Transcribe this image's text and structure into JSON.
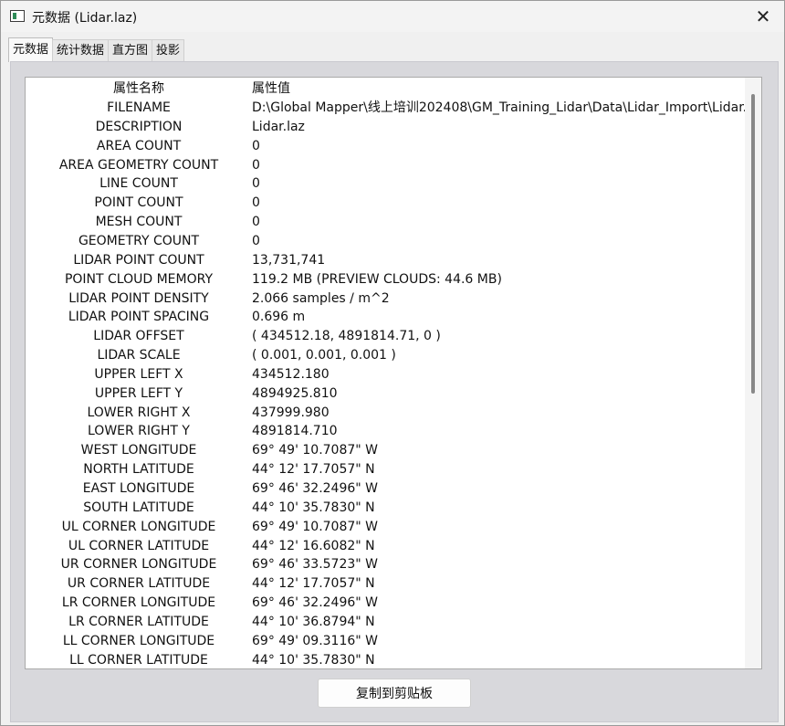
{
  "window": {
    "title": "元数据 (Lidar.laz)",
    "close_symbol": "✕"
  },
  "tabs": [
    {
      "label": "元数据",
      "active": true
    },
    {
      "label": "统计数据",
      "active": false
    },
    {
      "label": "直方图",
      "active": false
    },
    {
      "label": "投影",
      "active": false
    }
  ],
  "table": {
    "headers": {
      "name": "属性名称",
      "value": "属性值"
    },
    "rows": [
      {
        "name": "FILENAME",
        "value": "D:\\Global Mapper\\线上培训202408\\GM_Training_Lidar\\Data\\Lidar_Import\\Lidar.laz"
      },
      {
        "name": "DESCRIPTION",
        "value": "Lidar.laz"
      },
      {
        "name": "AREA COUNT",
        "value": "0"
      },
      {
        "name": "AREA GEOMETRY COUNT",
        "value": "0"
      },
      {
        "name": "LINE COUNT",
        "value": "0"
      },
      {
        "name": "POINT COUNT",
        "value": "0"
      },
      {
        "name": "MESH COUNT",
        "value": "0"
      },
      {
        "name": "GEOMETRY COUNT",
        "value": "0"
      },
      {
        "name": "LIDAR POINT COUNT",
        "value": "13,731,741"
      },
      {
        "name": "POINT CLOUD MEMORY",
        "value": "119.2 MB (PREVIEW CLOUDS: 44.6 MB)"
      },
      {
        "name": "LIDAR POINT DENSITY",
        "value": "2.066 samples / m^2"
      },
      {
        "name": "LIDAR POINT SPACING",
        "value": "0.696 m"
      },
      {
        "name": "LIDAR OFFSET",
        "value": "( 434512.18, 4891814.71, 0 )"
      },
      {
        "name": "LIDAR SCALE",
        "value": "( 0.001, 0.001, 0.001 )"
      },
      {
        "name": "UPPER LEFT X",
        "value": "434512.180"
      },
      {
        "name": "UPPER LEFT Y",
        "value": "4894925.810"
      },
      {
        "name": "LOWER RIGHT X",
        "value": "437999.980"
      },
      {
        "name": "LOWER RIGHT Y",
        "value": "4891814.710"
      },
      {
        "name": "WEST LONGITUDE",
        "value": "69° 49' 10.7087\" W"
      },
      {
        "name": "NORTH LATITUDE",
        "value": "44° 12' 17.7057\" N"
      },
      {
        "name": "EAST LONGITUDE",
        "value": "69° 46' 32.2496\" W"
      },
      {
        "name": "SOUTH LATITUDE",
        "value": "44° 10' 35.7830\" N"
      },
      {
        "name": "UL CORNER LONGITUDE",
        "value": "69° 49' 10.7087\" W"
      },
      {
        "name": "UL CORNER LATITUDE",
        "value": "44° 12' 16.6082\" N"
      },
      {
        "name": "UR CORNER LONGITUDE",
        "value": "69° 46' 33.5723\" W"
      },
      {
        "name": "UR CORNER LATITUDE",
        "value": "44° 12' 17.7057\" N"
      },
      {
        "name": "LR CORNER LONGITUDE",
        "value": "69° 46' 32.2496\" W"
      },
      {
        "name": "LR CORNER LATITUDE",
        "value": "44° 10' 36.8794\" N"
      },
      {
        "name": "LL CORNER LONGITUDE",
        "value": "69° 49' 09.3116\" W"
      },
      {
        "name": "LL CORNER LATITUDE",
        "value": "44° 10' 35.7830\" N"
      }
    ]
  },
  "footer": {
    "copy_button_label": "复制到剪贴板"
  },
  "icons": {
    "app": "window-app-icon",
    "close": "close-icon"
  }
}
